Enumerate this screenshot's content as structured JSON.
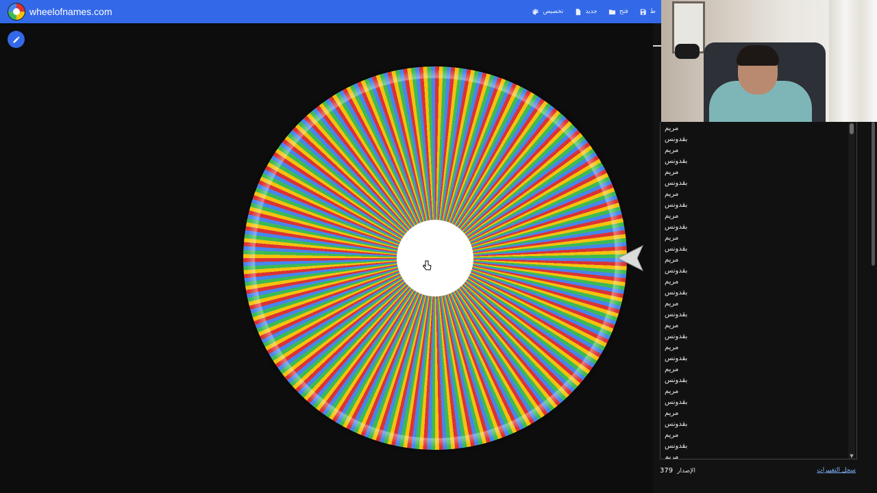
{
  "header": {
    "site_title": "wheelofnames.com",
    "menu": [
      {
        "label": "تخصيص",
        "icon": "palette-icon"
      },
      {
        "label": "جديد",
        "icon": "file-icon"
      },
      {
        "label": "فتح",
        "icon": "folder-icon"
      },
      {
        "label": "حفظ",
        "icon": "save-icon"
      }
    ],
    "menu_cut": "ط"
  },
  "entries": [
    "مريم",
    "بقدونس",
    "مريم",
    "بقدونس",
    "مريم",
    "بقدونس",
    "مريم",
    "بقدونس",
    "مريم",
    "بقدونس",
    "مريم",
    "بقدونس",
    "مريم",
    "بقدونس",
    "مريم",
    "بقدونس",
    "مريم",
    "بقدونس",
    "مريم",
    "بقدونس",
    "مريم",
    "بقدونس",
    "مريم",
    "بقدونس",
    "مريم",
    "بقدونس",
    "مريم",
    "بقدونس",
    "مريم",
    "بقدونس",
    "مريم"
  ],
  "footer": {
    "version_label": "الإصدار",
    "version_number": "379",
    "changelog": "سجل التغييرات"
  },
  "colors": {
    "accent": "#3369e8",
    "segments": [
      "#db3236",
      "#f4c20d",
      "#3cba54",
      "#4885ed"
    ]
  }
}
